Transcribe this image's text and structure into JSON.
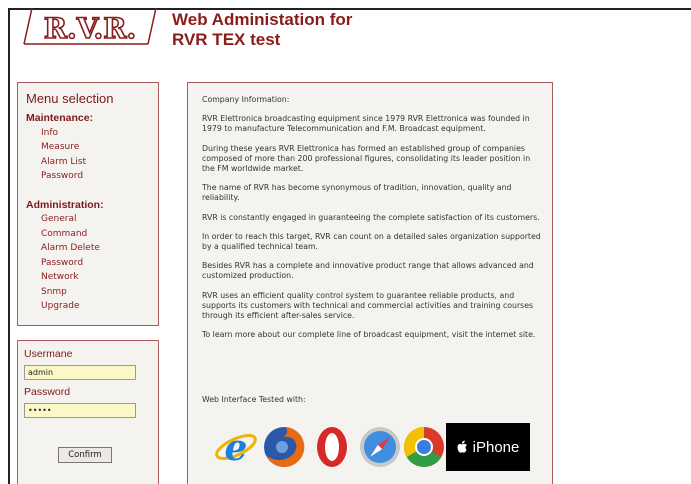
{
  "header": {
    "logo_text": "R.V.R.",
    "title_line1": "Web Administation for",
    "title_line2": "RVR TEX test"
  },
  "menu": {
    "title": "Menu selection",
    "maintenance": {
      "heading": "Maintenance:",
      "items": [
        "Info",
        "Measure",
        "Alarm List",
        "Password"
      ]
    },
    "administration": {
      "heading": "Administration:",
      "items": [
        "General",
        "Command",
        "Alarm Delete",
        "Password",
        "Network",
        "Snmp",
        "Upgrade"
      ]
    }
  },
  "login": {
    "username_label": "Usermane",
    "username_value": "admin",
    "password_label": "Password",
    "password_value": "•••••",
    "confirm_label": "Confirm"
  },
  "content": {
    "heading": "Company Information:",
    "paragraphs": [
      "RVR Elettronica broadcasting equipment since 1979 RVR Elettronica was founded in 1979 to manufacture Telecommunication and F.M. Broadcast equipment.",
      "During these years RVR Elettronica has formed an established group of companies composed of more than 200 professional figures, consolidating its leader position in the FM worldwide market.",
      "The name of RVR has become synonymous of tradition, innovation, quality and reliability.",
      "RVR is constantly engaged in guaranteeing the complete satisfaction of its customers.",
      "In order to reach this target, RVR can count on a detailed sales organization supported by a qualified technical team.",
      "Besides RVR has a complete and innovative product range that allows advanced and customized production.",
      "RVR uses an efficient quality control system to guarantee reliable products, and supports its customers with technical and commercial activities and training courses through its efficient after-sales service.",
      "To learn more about our complete line of broadcast equipment, visit the internet site."
    ],
    "tested_label": "Web Interface Tested with:",
    "iphone_label": "iPhone"
  },
  "colors": {
    "accent": "#8a1c1c",
    "panel_border": "#a85a5a",
    "panel_bg": "#f5f3f0",
    "input_bg": "#fbf8c8"
  }
}
